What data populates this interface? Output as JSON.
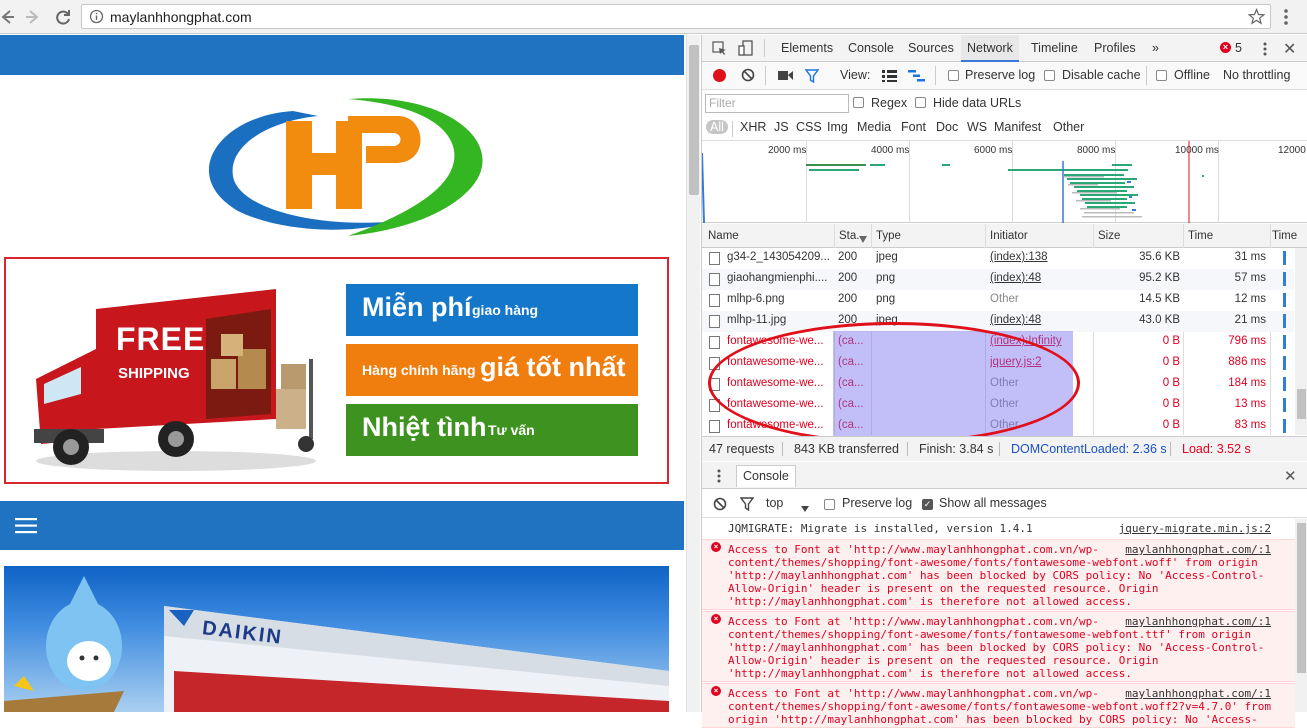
{
  "browser": {
    "url": "maylanhhongphat.com",
    "back_icon": "arrow-left",
    "forward_icon": "arrow-right",
    "reload_icon": "reload",
    "info_icon": "info",
    "star_icon": "star",
    "menu_icon": "kebab"
  },
  "site": {
    "banner_lines": [
      "Miễn phí giao hàng",
      "Hàng chính hãng giá tốt nhất",
      "Nhiệt tình Tư vấn"
    ],
    "banner_line1_big": "Miễn phí",
    "banner_line1_small": "giao hàng",
    "banner_line2_small": "Hàng chính hãng",
    "banner_line2_big": "giá tốt nhất",
    "banner_line3_big": "Nhiệt tình",
    "banner_line3_small": "Tư vấn",
    "truck_free": "FREE",
    "truck_shipping": "SHIPPING",
    "daikin": "DAIKIN",
    "colors": {
      "brand_blue": "#1f73c0",
      "banner_blue": "#1577c9",
      "banner_orange": "#f07e0f",
      "banner_green": "#3e9320"
    }
  },
  "devtools": {
    "tabs": [
      "Elements",
      "Console",
      "Sources",
      "Network",
      "Timeline",
      "Profiles"
    ],
    "active_tab": "Network",
    "more_tabs": "»",
    "error_count": "5",
    "toolbar": {
      "view_label": "View:",
      "preserve_log": "Preserve log",
      "disable_cache": "Disable cache",
      "offline": "Offline",
      "throttling": "No throttling"
    },
    "filter_placeholder": "Filter",
    "regex": "Regex",
    "hide_data_urls": "Hide data URLs",
    "types": [
      "All",
      "XHR",
      "JS",
      "CSS",
      "Img",
      "Media",
      "Font",
      "Doc",
      "WS",
      "Manifest",
      "Other"
    ],
    "timeline_ticks": [
      "2000 ms",
      "4000 ms",
      "6000 ms",
      "8000 ms",
      "10000 ms",
      "12000"
    ],
    "columns": [
      "Name",
      "Sta...",
      "Type",
      "Initiator",
      "Size",
      "Time",
      "Time"
    ],
    "rows": [
      {
        "name": "g34-2_143054209...",
        "status": "200",
        "type": "jpeg",
        "initiator": "(index):138",
        "size": "35.6 KB",
        "time": "31 ms",
        "error": false,
        "link": true
      },
      {
        "name": "giaohangmienphi....",
        "status": "200",
        "type": "png",
        "initiator": "(index):48",
        "size": "95.2 KB",
        "time": "57 ms",
        "error": false,
        "link": true
      },
      {
        "name": "mlhp-6.png",
        "status": "200",
        "type": "png",
        "initiator": "Other",
        "size": "14.5 KB",
        "time": "12 ms",
        "error": false,
        "link": false
      },
      {
        "name": "mlhp-11.jpg",
        "status": "200",
        "type": "jpeg",
        "initiator": "(index):48",
        "size": "43.0 KB",
        "time": "21 ms",
        "error": false,
        "link": true
      },
      {
        "name": "fontawesome-we...",
        "status": "(ca...",
        "type": "",
        "initiator": "(index):Infinity",
        "size": "0 B",
        "time": "796 ms",
        "error": true,
        "link": true
      },
      {
        "name": "fontawesome-we...",
        "status": "(ca...",
        "type": "",
        "initiator": "jquery.js:2",
        "size": "0 B",
        "time": "886 ms",
        "error": true,
        "link": true
      },
      {
        "name": "fontawesome-we...",
        "status": "(ca...",
        "type": "",
        "initiator": "Other",
        "size": "0 B",
        "time": "184 ms",
        "error": true,
        "link": false
      },
      {
        "name": "fontawesome-we...",
        "status": "(ca...",
        "type": "",
        "initiator": "Other",
        "size": "0 B",
        "time": "13 ms",
        "error": true,
        "link": false
      },
      {
        "name": "fontawesome-we...",
        "status": "(ca...",
        "type": "",
        "initiator": "Other",
        "size": "0 B",
        "time": "83 ms",
        "error": true,
        "link": false
      }
    ],
    "status": {
      "requests": "47 requests",
      "transferred": "843 KB transferred",
      "finish": "Finish: 3.84 s",
      "domcontentloaded": "DOMContentLoaded: 2.36 s",
      "load": "Load: 3.52 s"
    },
    "console": {
      "tab": "Console",
      "context": "top",
      "preserve_log": "Preserve log",
      "show_all": "Show all messages",
      "messages": [
        {
          "type": "log",
          "text": "JQMIGRATE: Migrate is installed, version 1.4.1",
          "source": "jquery-migrate.min.js:2"
        },
        {
          "type": "error",
          "text": "Access to Font at 'http://www.maylanhhongphat.com.vn/wp-\ncontent/themes/shopping/font-awesome/fonts/fontawesome-webfont.woff' from origin\n'http://maylanhhongphat.com' has been blocked by CORS policy: No 'Access-Control-\nAllow-Origin' header is present on the requested resource. Origin\n'http://maylanhhongphat.com' is therefore not allowed access.",
          "source": "maylanhhongphat.com/:1"
        },
        {
          "type": "error",
          "text": "Access to Font at 'http://www.maylanhhongphat.com.vn/wp-\ncontent/themes/shopping/font-awesome/fonts/fontawesome-webfont.ttf' from origin\n'http://maylanhhongphat.com' has been blocked by CORS policy: No 'Access-Control-\nAllow-Origin' header is present on the requested resource. Origin\n'http://maylanhhongphat.com' is therefore not allowed access.",
          "source": "maylanhhongphat.com/:1"
        },
        {
          "type": "error",
          "text": "Access to Font at 'http://www.maylanhhongphat.com.vn/wp-\ncontent/themes/shopping/font-awesome/fonts/fontawesome-webfont.woff2?v=4.7.0' from\norigin 'http://maylanhhongphat.com' has been blocked by CORS policy: No 'Access-",
          "source": "maylanhhongphat.com/:1"
        }
      ]
    },
    "colors": {
      "accent": "#3879d9",
      "error": "#e0001f",
      "record": "#e0101a"
    }
  }
}
